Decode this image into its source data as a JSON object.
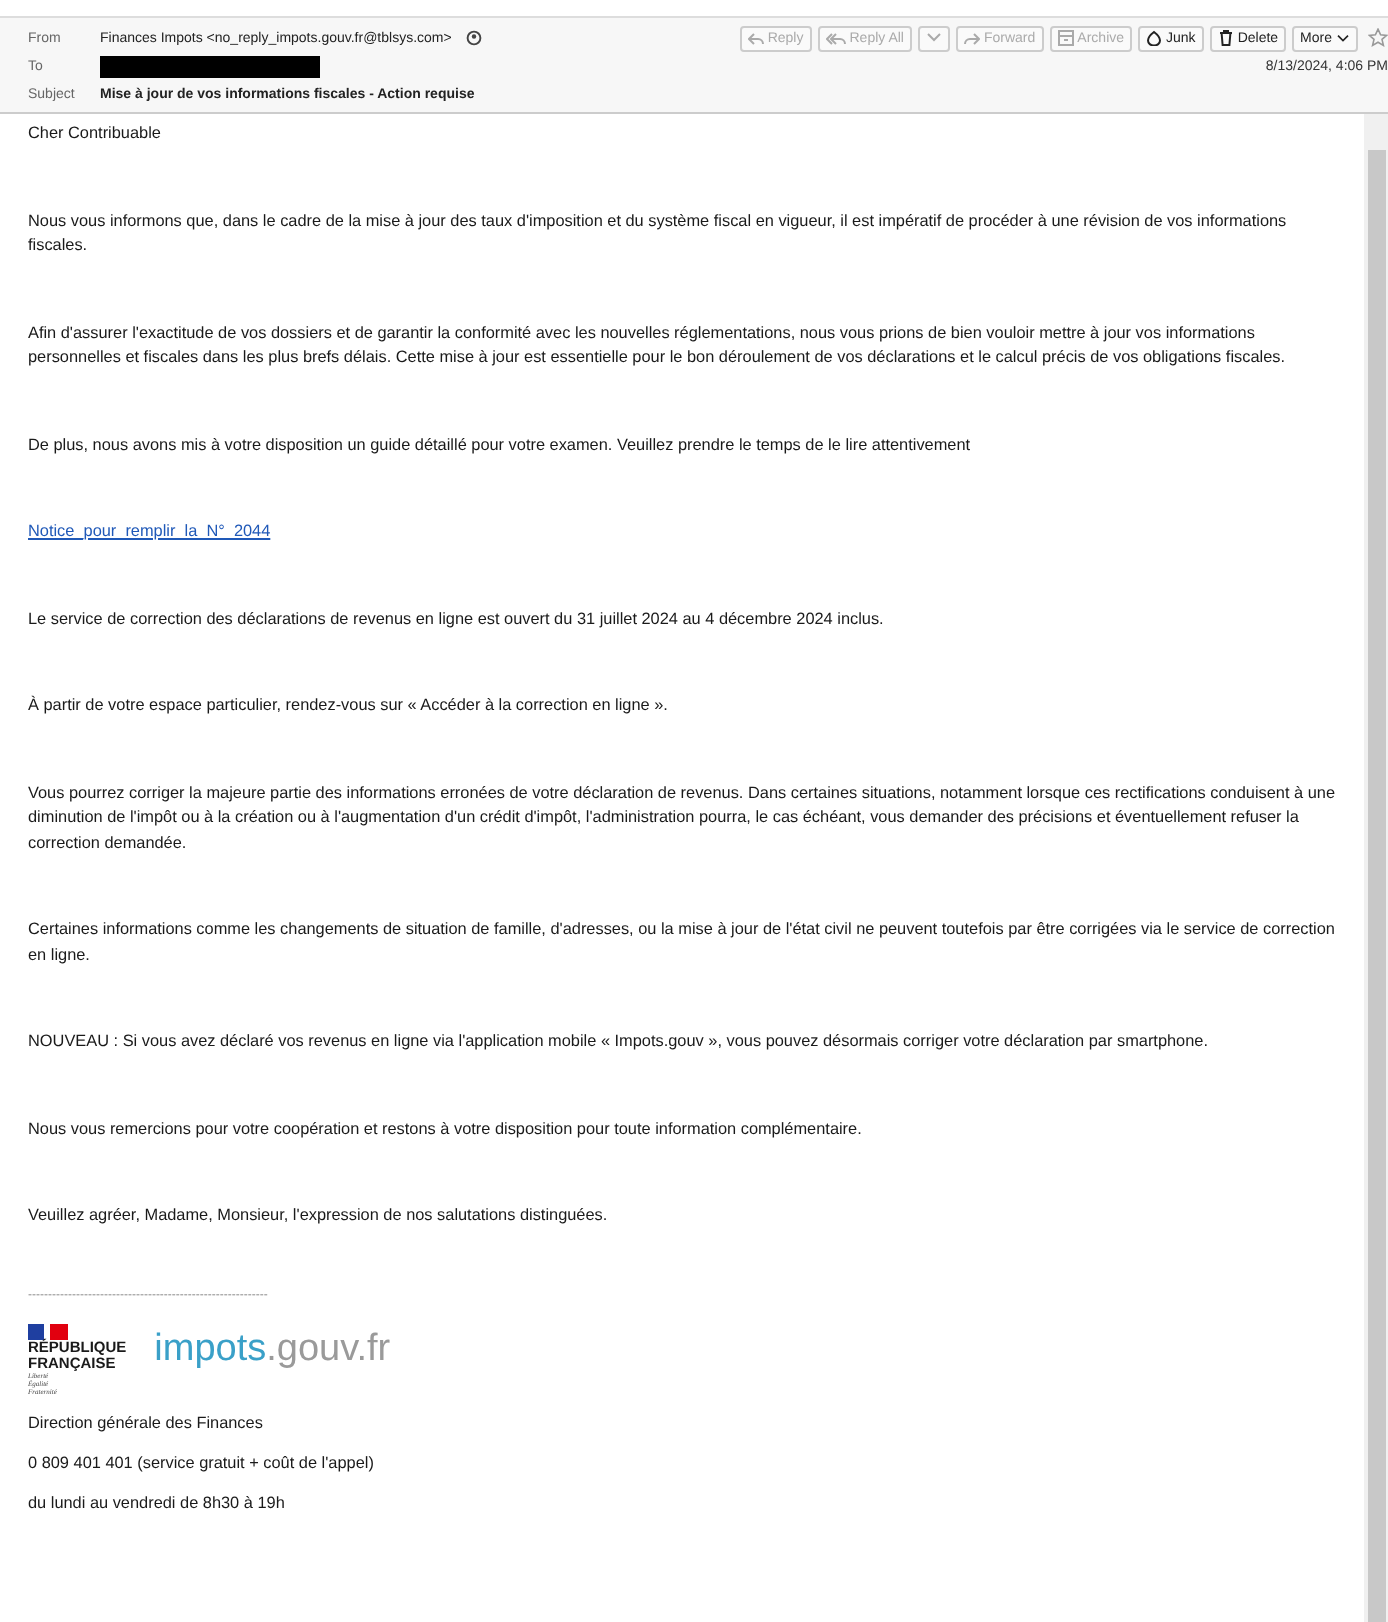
{
  "header": {
    "from_label": "From",
    "from": "Finances Impots <no_reply_impots.gouv.fr@tblsys.com>",
    "to_label": "To",
    "subject_label": "Subject",
    "subject": "Mise à jour de vos informations fiscales - Action requise",
    "date": "8/13/2024, 4:06 PM"
  },
  "toolbar": [
    {
      "kind": "reply",
      "label": "Reply",
      "disabled": true
    },
    {
      "kind": "reply-all",
      "label": "Reply All",
      "disabled": true
    },
    {
      "kind": "dropdown",
      "disabled": true
    },
    {
      "kind": "forward",
      "label": "Forward",
      "disabled": true
    },
    {
      "kind": "archive",
      "label": "Archive",
      "disabled": true
    },
    {
      "kind": "junk",
      "label": "Junk",
      "disabled": false
    },
    {
      "kind": "delete",
      "label": "Delete",
      "disabled": false
    },
    {
      "kind": "more",
      "label": "More",
      "disabled": false
    }
  ],
  "body": [
    {
      "kind": "text",
      "text": "Cher Contribuable"
    },
    {
      "kind": "text",
      "text": "Nous vous informons que, dans le cadre de la mise à jour des taux d'imposition et du système fiscal en vigueur, il est impératif de procéder à une révision de vos informations fiscales."
    },
    {
      "kind": "text",
      "text": "Afin d'assurer l'exactitude de vos dossiers et de garantir la conformité avec les nouvelles réglementations, nous vous prions de bien vouloir mettre à jour vos informations personnelles et fiscales dans les plus brefs délais. Cette mise à jour est essentielle pour le bon déroulement de vos déclarations et le calcul précis de vos obligations fiscales."
    },
    {
      "kind": "text",
      "text": "De plus, nous avons mis à votre disposition un guide détaillé pour votre examen. Veuillez prendre le temps de le lire attentivement"
    },
    {
      "kind": "link",
      "text": "Notice_pour_remplir_la_N°_2044"
    },
    {
      "kind": "text",
      "text": "Le service de correction des déclarations de revenus en ligne est ouvert du 31 juillet 2024 au 4 décembre 2024 inclus."
    },
    {
      "kind": "text",
      "text": "À partir de votre espace particulier, rendez-vous sur « Accéder à la correction en ligne »."
    },
    {
      "kind": "text",
      "text": "Vous pourrez corriger la majeure partie des informations erronées de votre déclaration de revenus. Dans certaines situations, notamment lorsque ces rectifications conduisent à une diminution de l'impôt ou à la création ou à l'augmentation d'un crédit d'impôt, l'administration pourra, le cas échéant, vous demander des précisions et éventuellement refuser la correction demandée."
    },
    {
      "kind": "text",
      "text": "Certaines informations comme les changements de situation de famille, d'adresses, ou la mise à jour de l'état civil ne peuvent toutefois par être corrigées via le service de correction en ligne."
    },
    {
      "kind": "text",
      "text": "NOUVEAU : Si vous avez déclaré vos revenus en ligne via l'application mobile « Impots.gouv », vous pouvez désormais corriger votre déclaration par smartphone."
    },
    {
      "kind": "text",
      "text": "Nous vous remercions pour votre coopération et restons à votre disposition pour toute information complémentaire."
    },
    {
      "kind": "text",
      "text": "Veuillez agréer, Madame, Monsieur, l'expression de nos salutations distinguées."
    }
  ],
  "signature": {
    "separator": "------------------------------------------------------------",
    "republique": "RÉPUBLIQUE",
    "francaise": "FRANÇAISE",
    "motto": [
      "Liberté",
      "Égalité",
      "Fraternité"
    ],
    "logo_main": "impots",
    "logo_rest": ".gouv.fr",
    "lines": [
      "Direction générale des Finances",
      "0 809 401 401 (service gratuit + coût de l'appel)",
      "du lundi au vendredi de 8h30 à 19h"
    ]
  }
}
